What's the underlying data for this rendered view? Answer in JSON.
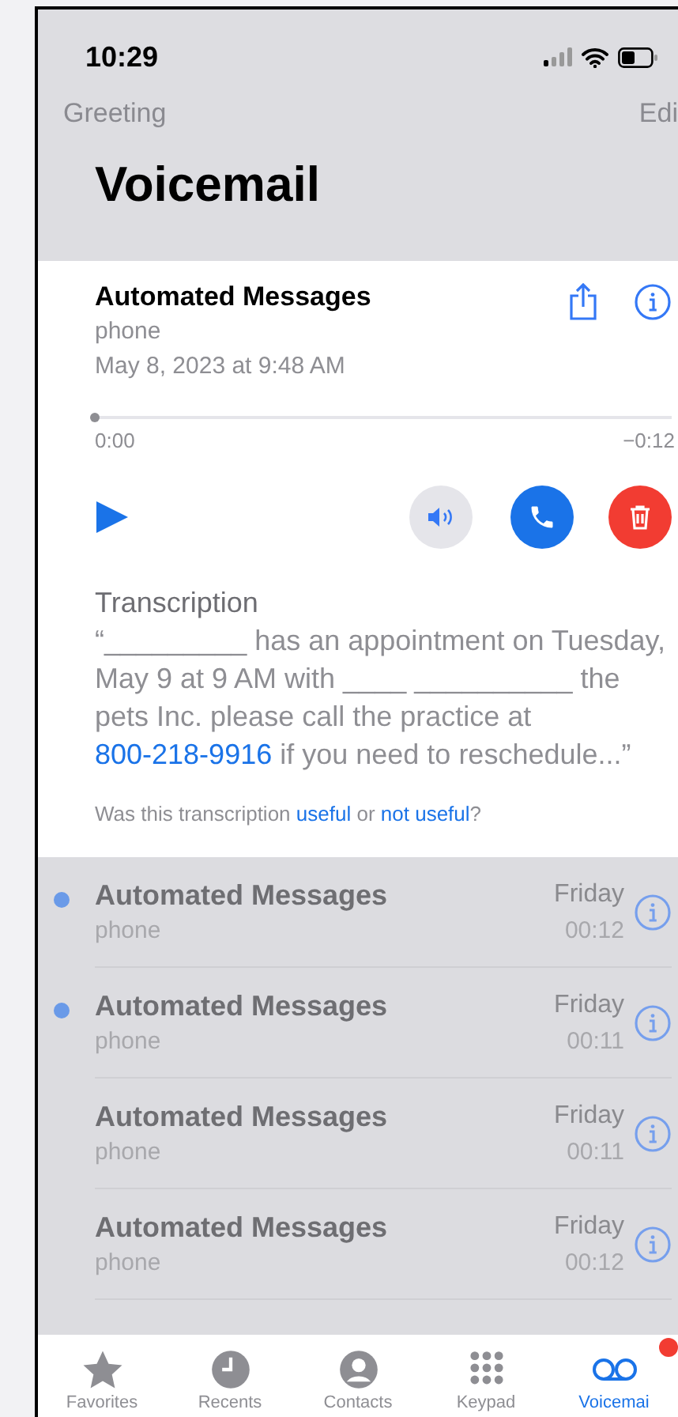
{
  "status_bar": {
    "time": "10:29"
  },
  "nav": {
    "left": "Greeting",
    "right": "Edi"
  },
  "title": "Voicemail",
  "detail": {
    "name": "Automated Messages",
    "label": "phone",
    "date": "May 8, 2023 at 9:48 AM",
    "playback": {
      "level": 0,
      "elapsed": "0:00",
      "remaining": "−0:12"
    },
    "speaker_on": false,
    "transcription": {
      "heading": "Transcription",
      "before": "“_________ has an appointment on Tuesday, May 9 at 9 AM with ____ __________ the pets Inc. please call the practice at ",
      "link": "800-218-9916",
      "after": " if you need to reschedule...”"
    },
    "feedback": {
      "before": "Was this transcription ",
      "useful": "useful",
      "middle": " or ",
      "not_useful": "not useful",
      "end": "?"
    }
  },
  "messages": [
    {
      "name": "Automated Messages",
      "label": "phone",
      "day": "Friday",
      "duration": "00:12",
      "unread": true
    },
    {
      "name": "Automated Messages",
      "label": "phone",
      "day": "Friday",
      "duration": "00:11",
      "unread": true
    },
    {
      "name": "Automated Messages",
      "label": "phone",
      "day": "Friday",
      "duration": "00:11",
      "unread": false
    },
    {
      "name": "Automated Messages",
      "label": "phone",
      "day": "Friday",
      "duration": "00:12",
      "unread": false
    }
  ],
  "tabs": [
    {
      "kind": "star",
      "label": "Favorites",
      "selected": false
    },
    {
      "kind": "clock",
      "label": "Recents",
      "selected": false
    },
    {
      "kind": "person",
      "label": "Contacts",
      "selected": false
    },
    {
      "kind": "keypad",
      "label": "Keypad",
      "selected": false
    },
    {
      "kind": "voicemail",
      "label": "Voicemai",
      "selected": true,
      "badge": true
    }
  ]
}
